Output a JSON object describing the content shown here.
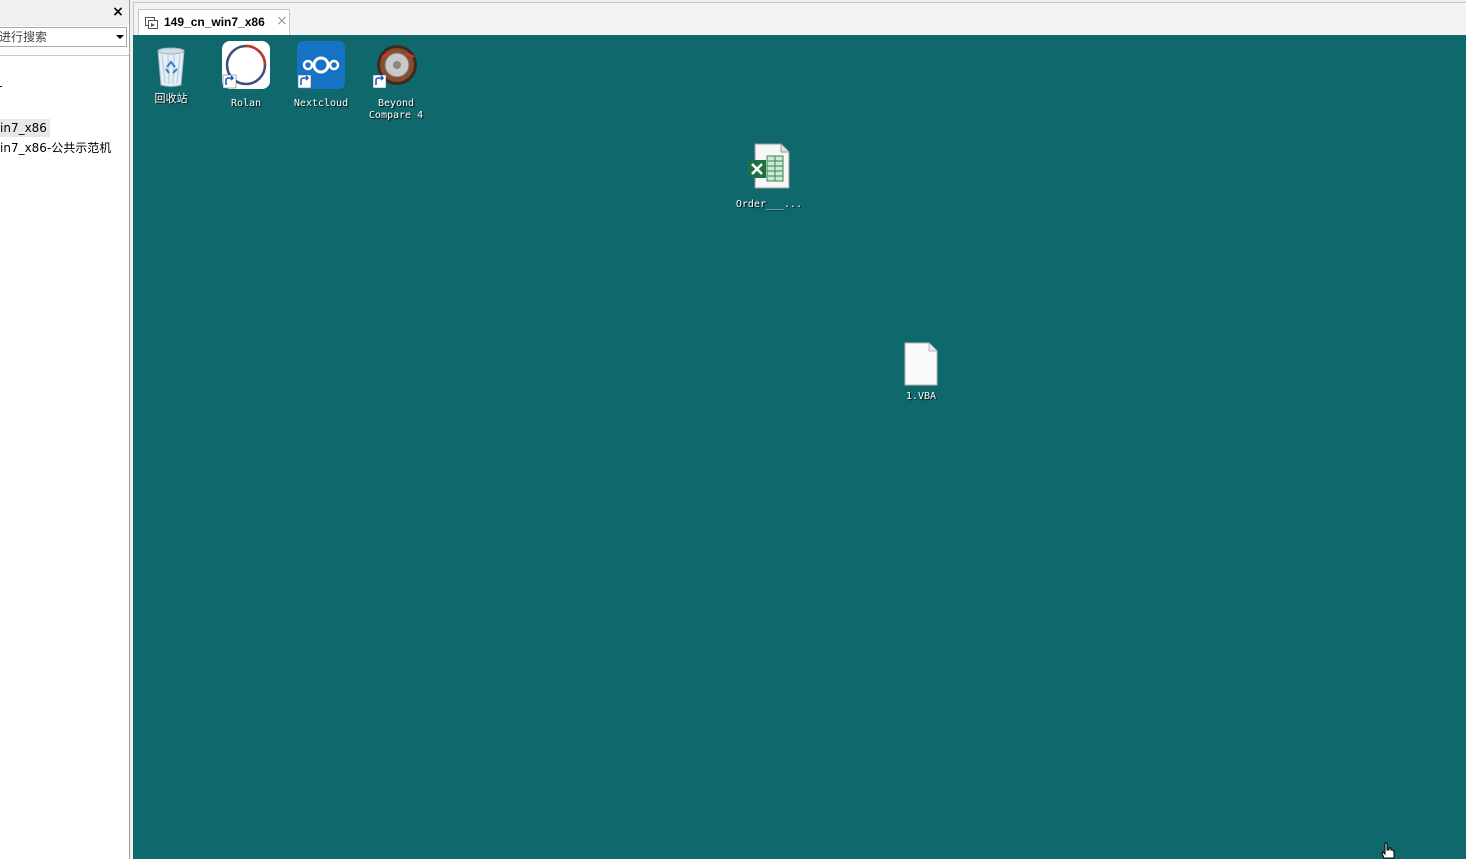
{
  "left_panel": {
    "close_glyph": "×",
    "search_placeholder": "在此处键入内容进行搜索",
    "search_visible_text": "进行搜索",
    "tree_items": [
      {
        "label": "in7_x86"
      },
      {
        "label": "in7_x86-公共示范机"
      }
    ]
  },
  "tabs": [
    {
      "label": "149_cn_win7_x86",
      "close_glyph": "×",
      "icon": "vm-tab-icon"
    }
  ],
  "desktop": {
    "background": "#0f696c",
    "icons": [
      {
        "name": "recycle-bin",
        "label": "回收站",
        "icon": "recycle-bin-icon"
      },
      {
        "name": "rolan",
        "label": "Rolan",
        "icon": "rolan-icon",
        "shortcut": true
      },
      {
        "name": "nextcloud",
        "label": "Nextcloud",
        "icon": "nextcloud-icon",
        "shortcut": true
      },
      {
        "name": "beyond-compare",
        "label_line1": "Beyond",
        "label_line2": "Compare 4",
        "icon": "beyond-compare-icon",
        "shortcut": true
      },
      {
        "name": "excel-file",
        "label": "Order___...",
        "icon": "excel-file-icon"
      },
      {
        "name": "vba-file",
        "label": "1.VBA",
        "icon": "blank-file-icon"
      }
    ]
  }
}
